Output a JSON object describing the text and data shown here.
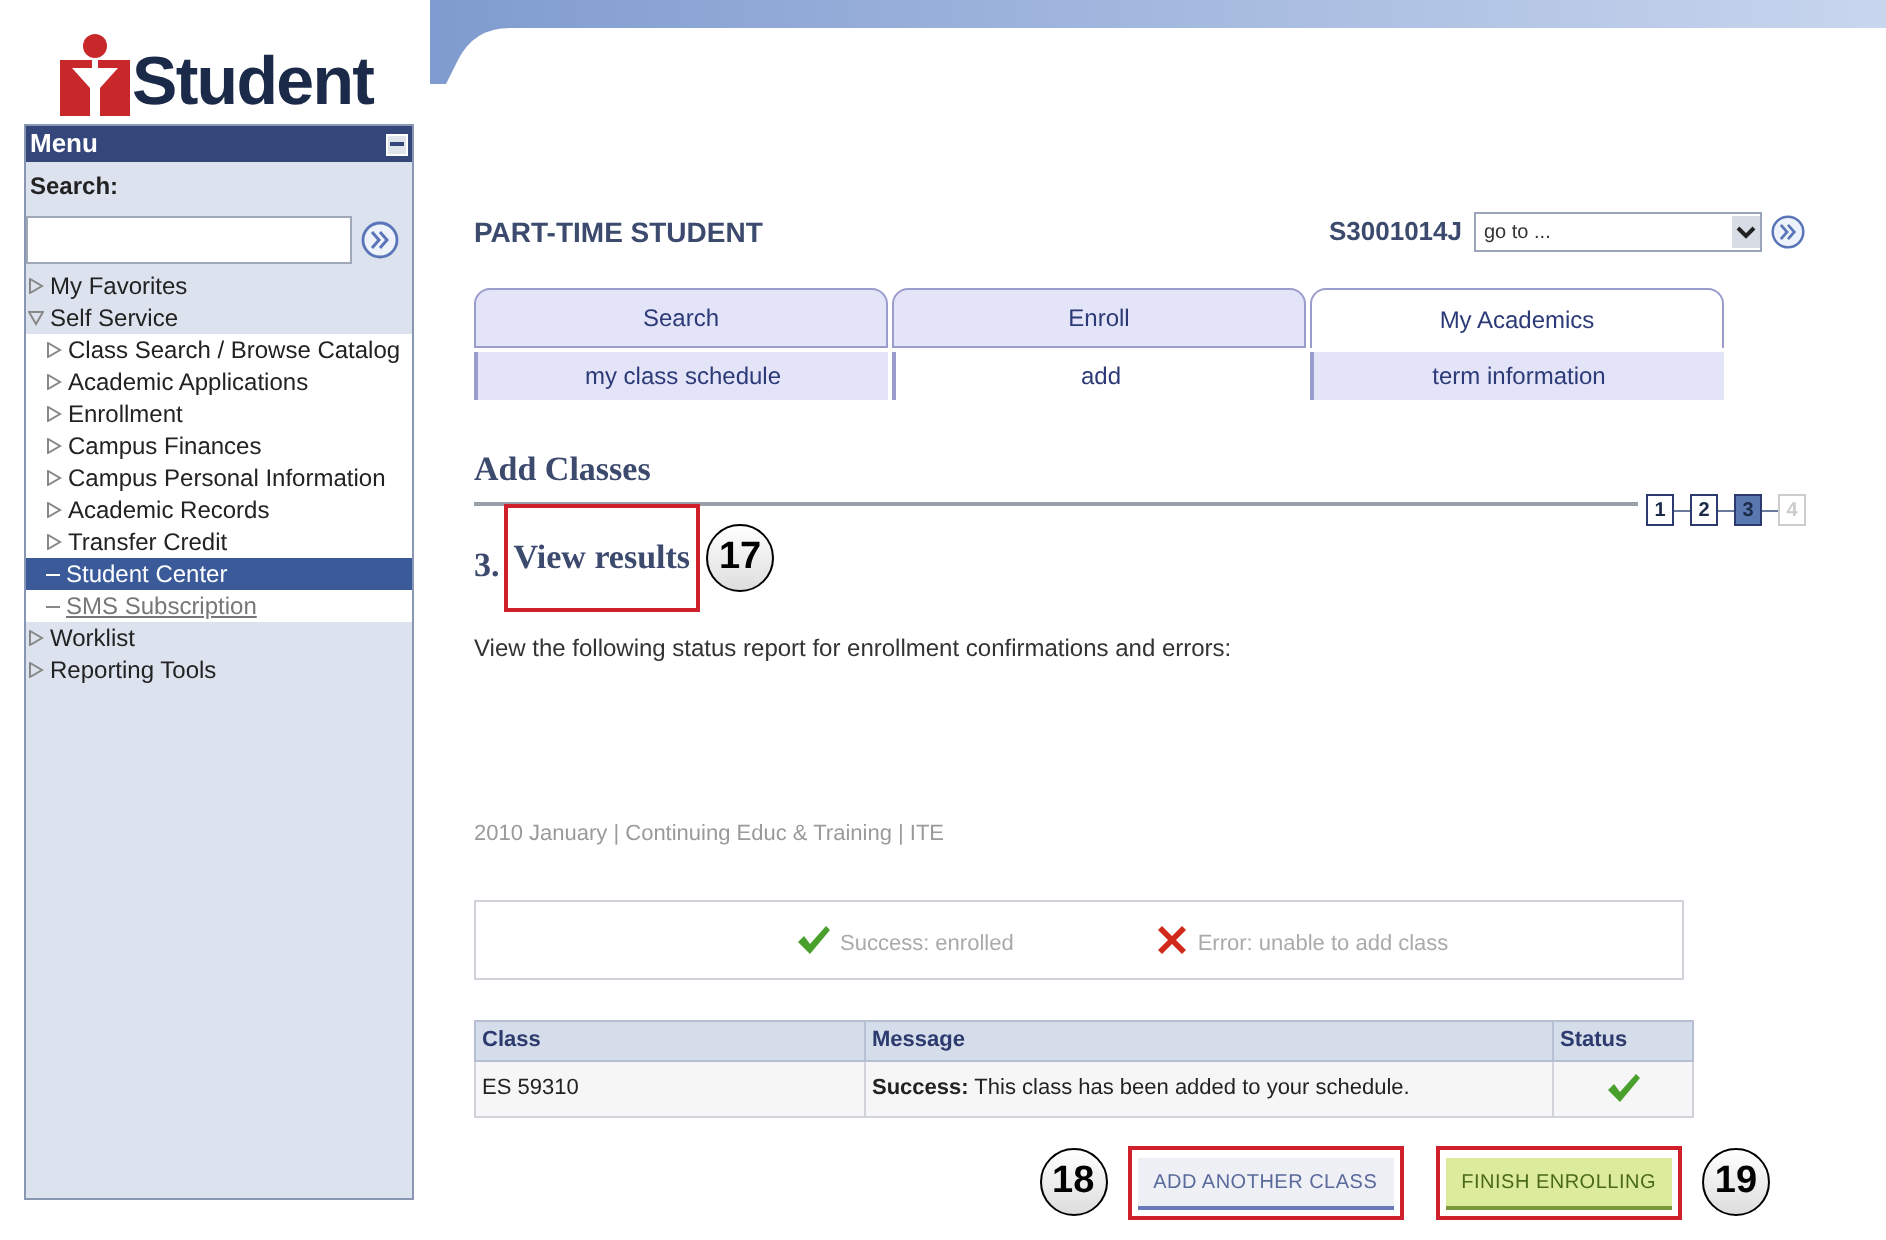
{
  "logo": {
    "text": "Student"
  },
  "menu": {
    "title": "Menu",
    "search_label": "Search:",
    "items": [
      {
        "label": "My Favorites",
        "kind": "folder",
        "expanded": false,
        "selected": false
      },
      {
        "label": "Self Service",
        "kind": "folder",
        "expanded": true,
        "selected": false,
        "children": [
          {
            "label": "Class Search / Browse Catalog",
            "kind": "folder",
            "expanded": false,
            "selected": false
          },
          {
            "label": "Academic Applications",
            "kind": "folder",
            "expanded": false,
            "selected": false
          },
          {
            "label": "Enrollment",
            "kind": "folder",
            "expanded": false,
            "selected": false
          },
          {
            "label": "Campus Finances",
            "kind": "folder",
            "expanded": false,
            "selected": false
          },
          {
            "label": "Campus Personal Information",
            "kind": "folder",
            "expanded": false,
            "selected": false
          },
          {
            "label": "Academic Records",
            "kind": "folder",
            "expanded": false,
            "selected": false
          },
          {
            "label": "Transfer Credit",
            "kind": "folder",
            "expanded": false,
            "selected": false
          },
          {
            "label": "Student Center",
            "kind": "link",
            "selected": true
          },
          {
            "label": "SMS Subscription",
            "kind": "link",
            "selected": false
          }
        ]
      },
      {
        "label": "Worklist",
        "kind": "folder",
        "expanded": false,
        "selected": false
      },
      {
        "label": "Reporting Tools",
        "kind": "folder",
        "expanded": false,
        "selected": false
      }
    ]
  },
  "header": {
    "role": "PART-TIME STUDENT",
    "student_id": "S3001014J",
    "goto": "go to ..."
  },
  "tabs": [
    {
      "label": "Search",
      "selected": false
    },
    {
      "label": "Enroll",
      "selected": false
    },
    {
      "label": "My Academics",
      "selected": true
    }
  ],
  "subtabs": [
    {
      "label": "my class schedule",
      "selected": false
    },
    {
      "label": "add",
      "selected": true
    },
    {
      "label": "term information",
      "selected": false
    }
  ],
  "page_title": "Add Classes",
  "steps": [
    {
      "label": "1",
      "selected": false,
      "disabled": false
    },
    {
      "label": "2",
      "selected": false,
      "disabled": false
    },
    {
      "label": "3",
      "selected": true,
      "disabled": false
    },
    {
      "label": "4",
      "selected": false,
      "disabled": true
    }
  ],
  "step_heading": {
    "number": "3.",
    "title": "View results",
    "highlighted": true,
    "callout": "17"
  },
  "instructions": "View the following status report for enrollment confirmations and errors:",
  "term": "2010 January | Continuing Educ & Training | ITE",
  "legend": [
    {
      "kind": "success",
      "label": "Success: enrolled"
    },
    {
      "kind": "error",
      "label": "Error: unable to add class"
    }
  ],
  "table": {
    "columns": [
      "Class",
      "Message",
      "Status"
    ],
    "rows": [
      {
        "class": "ES 59310",
        "message": "**Success:** This class has been added to your schedule.",
        "status": {
          "kind": "success"
        }
      }
    ]
  },
  "buttons": [
    {
      "label": "ADD ANOTHER CLASS",
      "kind": "secondary",
      "highlighted": true,
      "callout": "18"
    },
    {
      "label": "FINISH ENROLLING",
      "kind": "primary",
      "highlighted": true,
      "callout": "19"
    }
  ]
}
